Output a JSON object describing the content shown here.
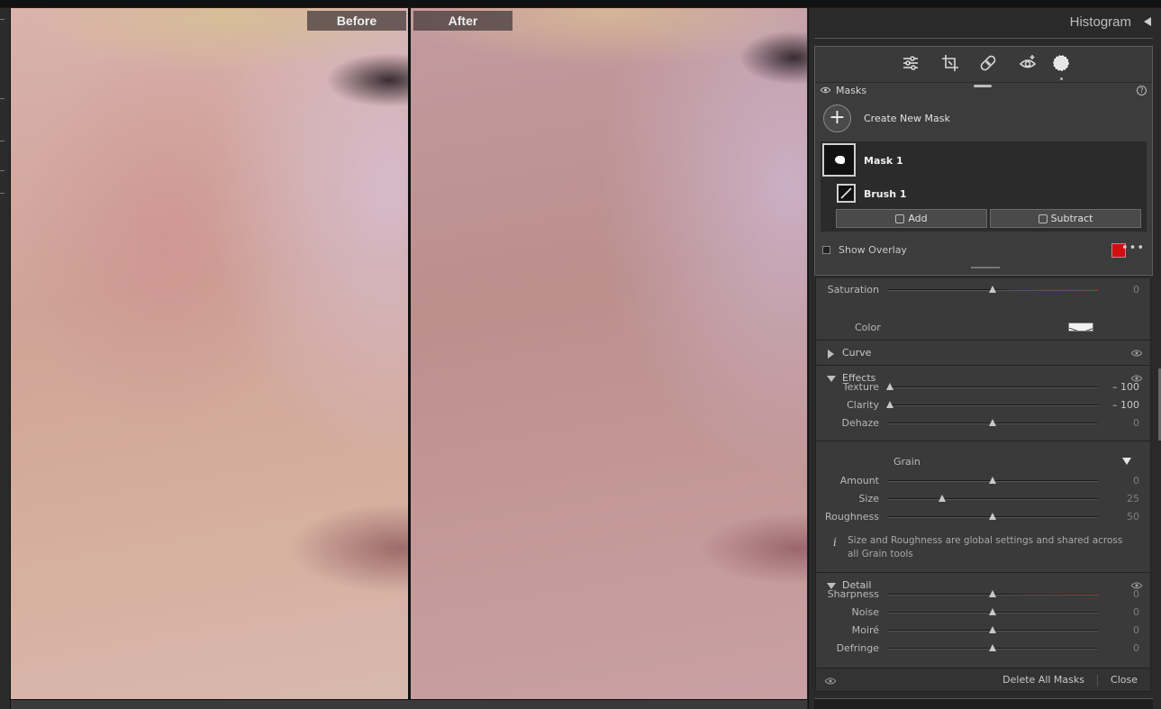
{
  "preview": {
    "before_label": "Before",
    "after_label": "After"
  },
  "panel": {
    "histogram_title": "Histogram",
    "tools": [
      "edit-sliders-icon",
      "crop-icon",
      "healing-icon",
      "red-eye-icon",
      "masking-icon"
    ],
    "masks": {
      "title": "Masks",
      "create_label": "Create New Mask",
      "create_glyph": "+",
      "mask_name": "Mask 1",
      "brush_name": "Brush 1",
      "add_label": "Add",
      "subtract_label": "Subtract",
      "overlay_label": "Show Overlay",
      "overlay_color": "#d01010",
      "more_glyph": "•••",
      "help_glyph": "?"
    },
    "adjust": {
      "saturation": {
        "label": "Saturation",
        "value": "0"
      },
      "color_label": "Color",
      "curve_title": "Curve",
      "effects_title": "Effects",
      "texture": {
        "label": "Texture",
        "value": "– 100"
      },
      "clarity": {
        "label": "Clarity",
        "value": "– 100"
      },
      "dehaze": {
        "label": "Dehaze",
        "value": "0"
      },
      "grain_title": "Grain",
      "amount": {
        "label": "Amount",
        "value": "0"
      },
      "size": {
        "label": "Size",
        "value": "25"
      },
      "roughness": {
        "label": "Roughness",
        "value": "50"
      },
      "info_glyph": "i",
      "info_text": "Size and Roughness are global settings and shared across all Grain tools",
      "detail_title": "Detail",
      "sharpness": {
        "label": "Sharpness",
        "value": "0"
      },
      "noise": {
        "label": "Noise",
        "value": "0"
      },
      "moire": {
        "label": "Moiré",
        "value": "0"
      },
      "defringe": {
        "label": "Defringe",
        "value": "0"
      }
    },
    "footer": {
      "delete_all": "Delete All Masks",
      "close": "Close"
    }
  }
}
